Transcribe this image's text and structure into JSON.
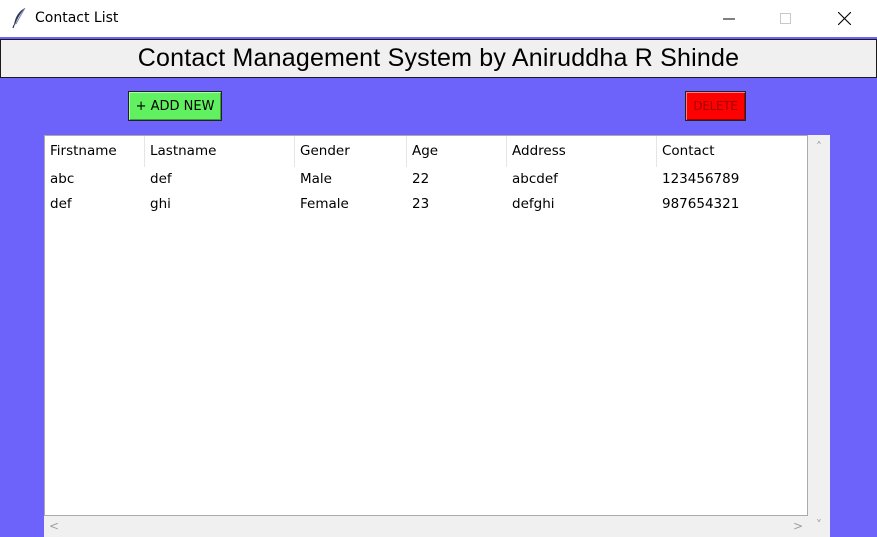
{
  "window": {
    "title": "Contact List",
    "icon": "feather-icon"
  },
  "header": {
    "title": "Contact Management System by Aniruddha R Shinde"
  },
  "toolbar": {
    "add_label": "+ ADD NEW",
    "delete_label": "DELETE"
  },
  "table": {
    "columns": [
      "Firstname",
      "Lastname",
      "Gender",
      "Age",
      "Address",
      "Contact"
    ],
    "rows": [
      [
        "abc",
        "def",
        "Male",
        "22",
        "abcdef",
        "123456789"
      ],
      [
        "def",
        "ghi",
        "Female",
        "23",
        "defghi",
        "987654321"
      ]
    ]
  },
  "scroll": {
    "up": "˄",
    "down": "˅",
    "left": "<",
    "right": ">"
  },
  "colors": {
    "background": "#6d63fb",
    "add_button": "#60f060",
    "delete_button": "#ff0000"
  }
}
